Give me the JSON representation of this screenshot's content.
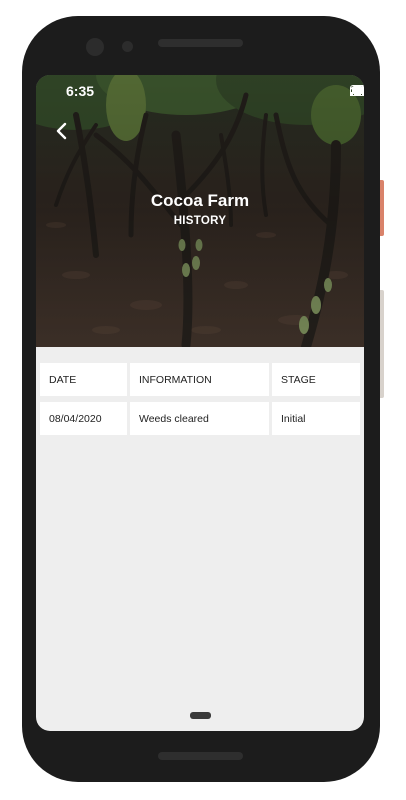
{
  "status_bar": {
    "time": "6:35"
  },
  "header": {
    "title": "Cocoa Farm",
    "subtitle": "HISTORY",
    "back_icon": "chevron-left-icon"
  },
  "table": {
    "columns": [
      "DATE",
      "INFORMATION",
      "STAGE"
    ],
    "rows": [
      [
        "08/04/2020",
        "Weeds cleared",
        "Initial"
      ]
    ]
  },
  "colors": {
    "device": "#1c1c1c",
    "screen_bg": "#eeeeee",
    "cell_bg": "#ffffff",
    "side_accent": "#d9826a"
  }
}
